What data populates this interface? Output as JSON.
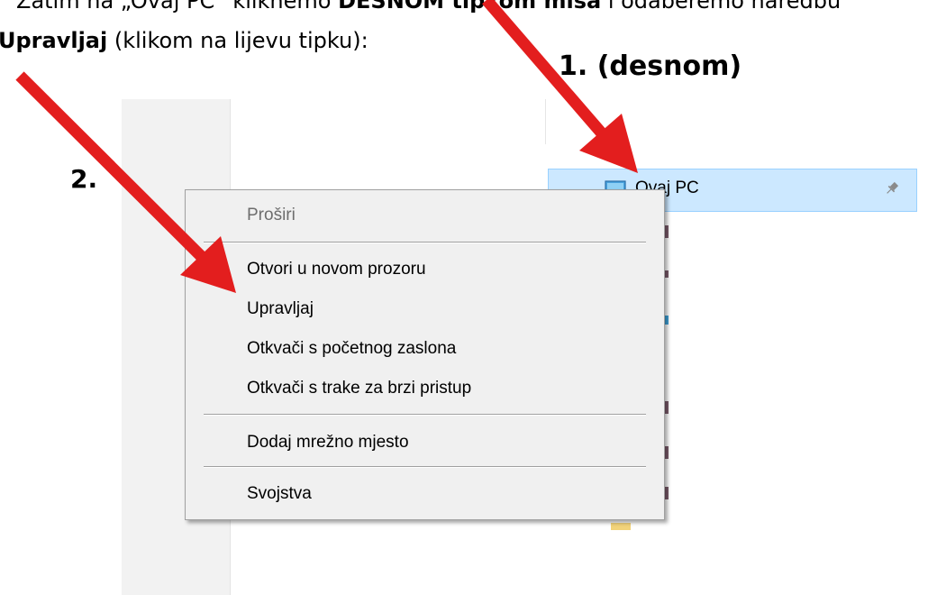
{
  "document": {
    "line1_before": "Zatim na „Ovaj PC“ kliknemo ",
    "line1_bold": "DESNOM tipkom miša",
    "line1_after": " i odaberemo naredbu",
    "line2_bold": "Upravljaj",
    "line2_after": " (klikom na lijevu tipku):"
  },
  "annotations": {
    "step1": "1. (desnom)",
    "step2": "2."
  },
  "quick_access": {
    "selected_item_label": "Ovaj PC",
    "selected_item_icon": "monitor-icon",
    "pin_icon": "pin-icon",
    "highlight_color": "#cce8ff"
  },
  "context_menu": {
    "items": [
      {
        "label": "Proširi",
        "enabled": false
      },
      {
        "label": "Otvori u novom prozoru",
        "enabled": true
      },
      {
        "label": "Upravljaj",
        "enabled": true
      },
      {
        "label": "Otkvači s početnog zaslona",
        "enabled": true
      },
      {
        "label": "Otkvači s trake za brzi pristup",
        "enabled": true
      },
      {
        "label": "Dodaj mrežno mjesto",
        "enabled": true
      },
      {
        "label": "Svojstva",
        "enabled": true
      }
    ]
  },
  "colors": {
    "arrow": "#e31e1e",
    "menu_background": "#f0f0f0"
  }
}
